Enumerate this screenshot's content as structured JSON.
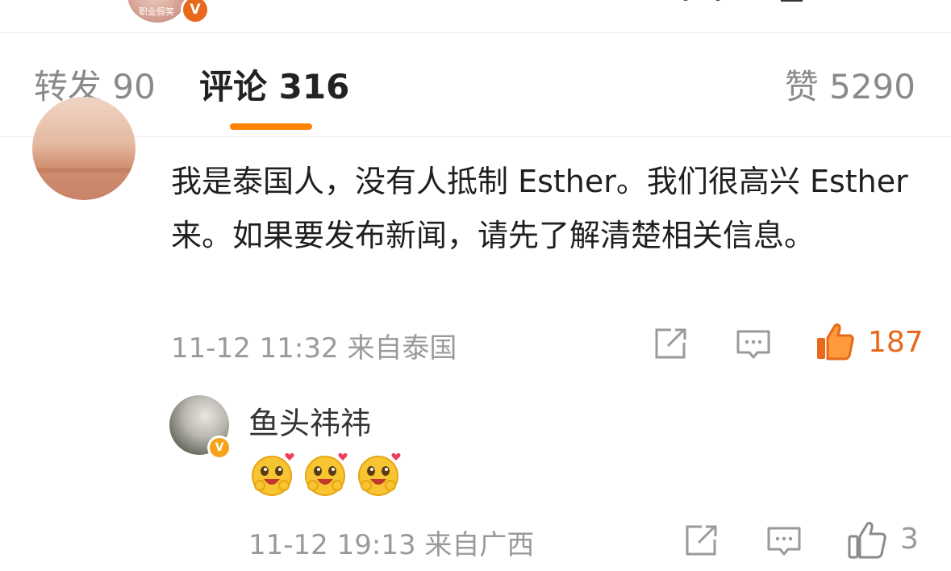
{
  "header": {
    "avatar_caption": "职业假笑",
    "verified_mark": "V"
  },
  "tabs": {
    "repost": {
      "label": "转发",
      "count": "90"
    },
    "comment": {
      "label": "评论",
      "count": "316"
    },
    "like": {
      "label": "赞",
      "count": "5290"
    }
  },
  "comments": [
    {
      "text": "我是泰国人，没有人抵制 Esther。我们很高兴 Esther 来。如果要发布新闻，请先了解清楚相关信息。",
      "time": "11-12 11:32",
      "location": "来自泰国",
      "like_count": "187",
      "liked": true,
      "icons": [
        "share-icon",
        "comment-icon",
        "thumbs-up-icon"
      ]
    }
  ],
  "reply": {
    "user": "鱼头祎祎",
    "verified_mark": "V",
    "emojis": [
      "love-face-emoji",
      "love-face-emoji",
      "love-face-emoji"
    ],
    "time": "11-12 19:13",
    "location": "来自广西",
    "like_count": "3",
    "liked": false
  },
  "colors": {
    "accent": "#ff8200",
    "liked": "#e8691b",
    "muted": "#9a9a9a",
    "verified": "#f6a31a"
  }
}
